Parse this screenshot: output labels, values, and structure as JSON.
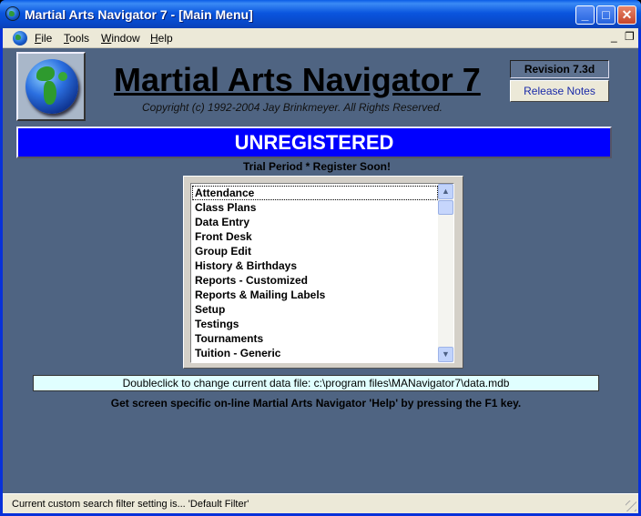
{
  "window": {
    "title": "Martial Arts Navigator 7 - [Main Menu]",
    "controls": {
      "minimize": "_",
      "maximize": "□",
      "close": "✕"
    }
  },
  "menubar": {
    "items": [
      "File",
      "Tools",
      "Window",
      "Help"
    ],
    "mdi_minimize": "_",
    "mdi_restore": "❐"
  },
  "header": {
    "app_title": "Martial Arts Navigator 7",
    "copyright": "Copyright (c) 1992-2004 Jay Brinkmeyer. All Rights Reserved.",
    "revision": "Revision 7.3d",
    "release_notes_label": "Release Notes"
  },
  "banner": {
    "text": "UNREGISTERED",
    "trial": "Trial Period * Register Soon!"
  },
  "modules": {
    "items": [
      "Attendance",
      "Class Plans",
      "Data Entry",
      "Front Desk",
      "Group Edit",
      "History & Birthdays",
      "Reports - Customized",
      "Reports & Mailing Labels",
      "Setup",
      "Testings",
      "Tournaments",
      "Tuition - Generic"
    ],
    "focused_index": 0
  },
  "datafile": {
    "text": "Doubleclick to change current data file: c:\\program files\\MANavigator7\\data.mdb"
  },
  "help": {
    "text": "Get screen specific on-line Martial Arts Navigator 'Help' by pressing the F1 key."
  },
  "status": {
    "text": "Current custom search filter setting is... 'Default Filter'"
  },
  "colors": {
    "client_bg": "#4f6482",
    "banner_bg": "#0000ff",
    "datafile_bg": "#e0ffff"
  }
}
